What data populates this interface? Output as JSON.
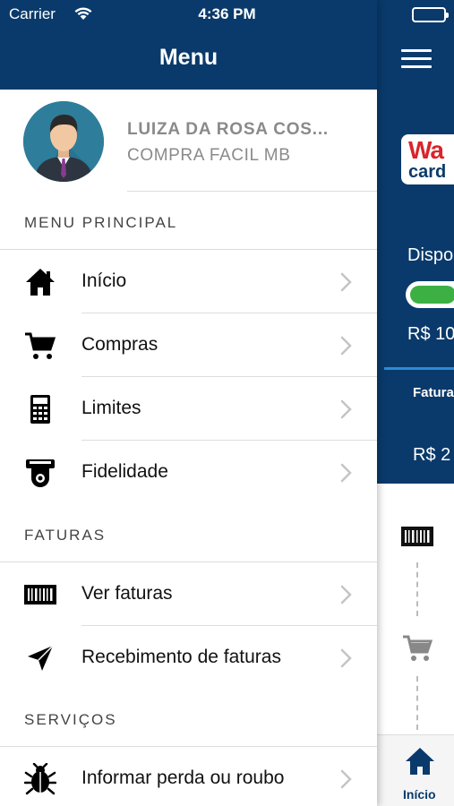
{
  "status_bar": {
    "carrier": "Carrier",
    "time": "4:36 PM"
  },
  "background_app": {
    "logo_line1": "Wa",
    "logo_line2": "card",
    "available_label": "Dispo",
    "available_fraction": 0.85,
    "available_value": "R$ 10",
    "invoices_label": "Fatura",
    "invoice_value": "R$ 2",
    "tab_home_label": "Início"
  },
  "drawer": {
    "title": "Menu",
    "profile": {
      "name": "LUIZA DA ROSA COS...",
      "subtitle": "COMPRA FACIL MB"
    },
    "sections": {
      "main": {
        "title": "MENU PRINCIPAL",
        "items": [
          {
            "label": "Início",
            "icon": "home-icon"
          },
          {
            "label": "Compras",
            "icon": "cart-icon"
          },
          {
            "label": "Limites",
            "icon": "calculator-icon"
          },
          {
            "label": "Fidelidade",
            "icon": "loyalty-icon"
          }
        ]
      },
      "invoices": {
        "title": "FATURAS",
        "items": [
          {
            "label": "Ver faturas",
            "icon": "barcode-icon"
          },
          {
            "label": "Recebimento de faturas",
            "icon": "send-icon"
          }
        ]
      },
      "services": {
        "title": "SERVIÇOS",
        "items": [
          {
            "label": "Informar perda ou roubo",
            "icon": "bug-icon"
          }
        ]
      }
    }
  },
  "colors": {
    "primary": "#0a3a6b",
    "accent_green": "#3cb043",
    "accent_blue": "#2f8ad6",
    "logo_red": "#d9242b"
  }
}
